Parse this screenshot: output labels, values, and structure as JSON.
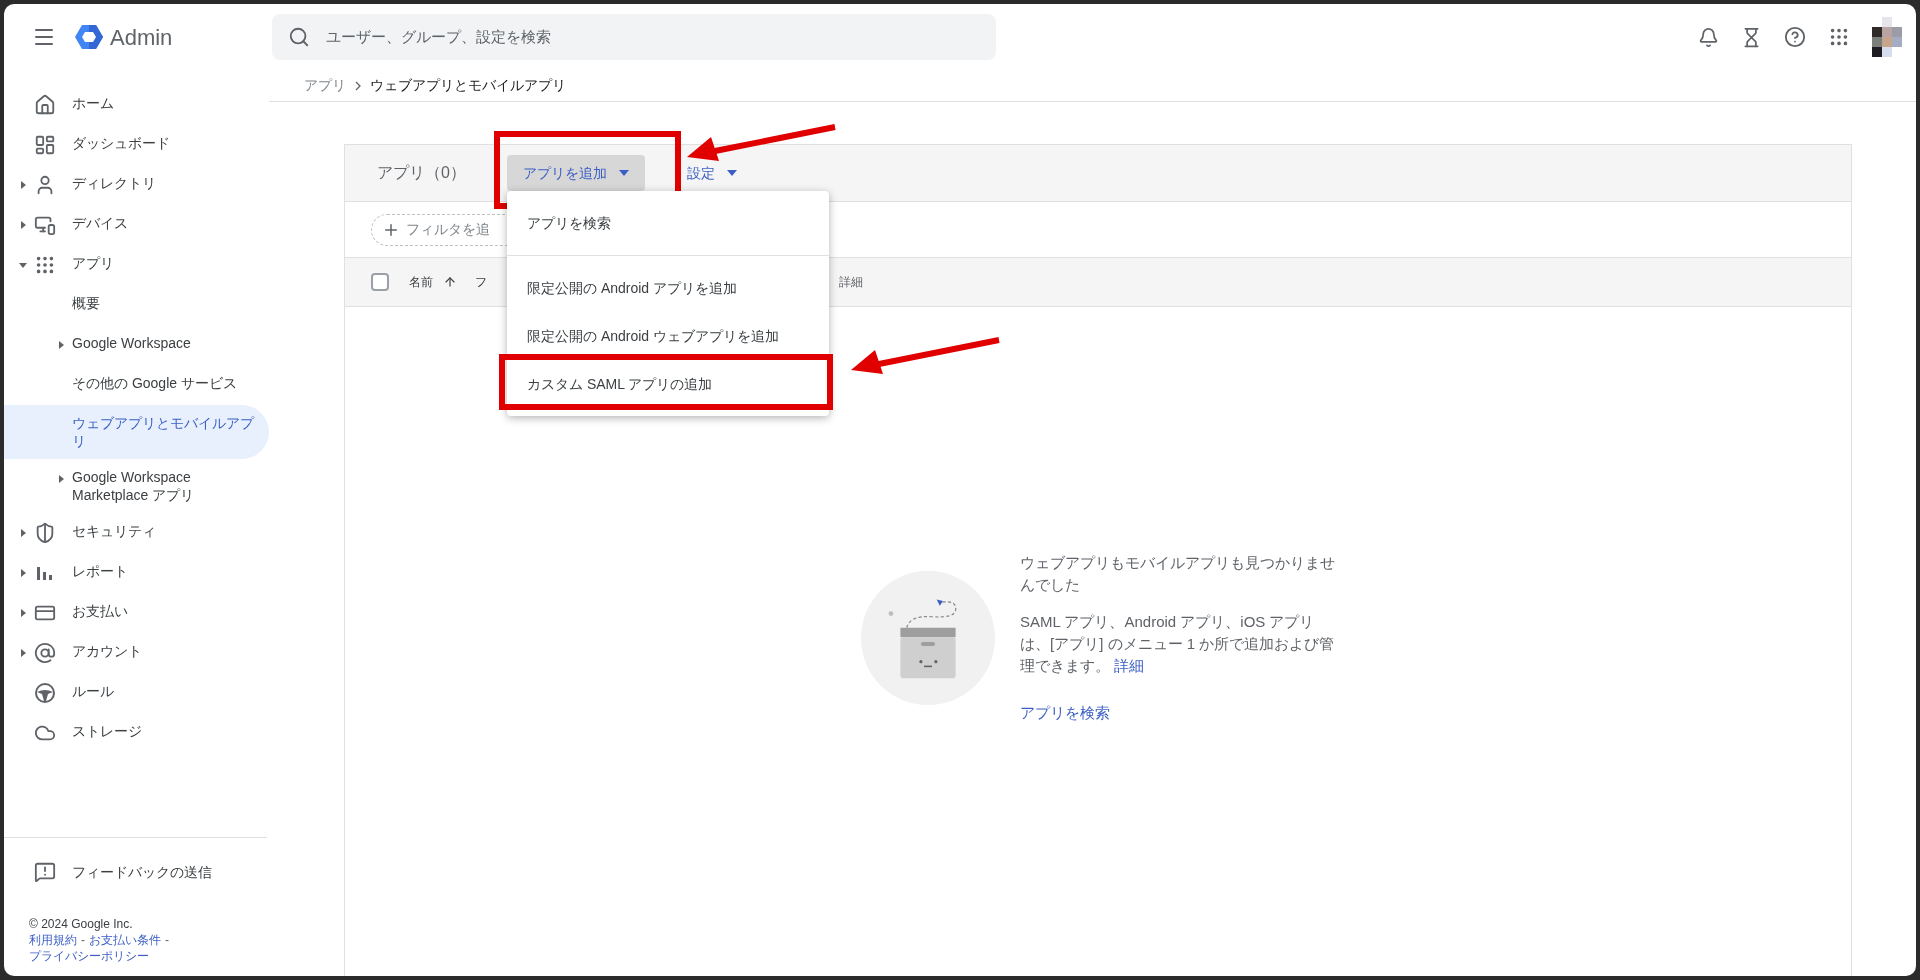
{
  "header": {
    "product": "Admin",
    "search": {
      "placeholder": "ユーザー、グループ、設定を検索"
    }
  },
  "sidebar": {
    "items": [
      {
        "kind": "link",
        "label": "ホーム"
      },
      {
        "kind": "link",
        "label": "ダッシュボード"
      },
      {
        "kind": "group",
        "label": "ディレクトリ",
        "expanded": false
      },
      {
        "kind": "group",
        "label": "デバイス",
        "expanded": false
      },
      {
        "kind": "group",
        "label": "アプリ",
        "expanded": true,
        "children": [
          {
            "kind": "link",
            "label": "概要",
            "selected": false
          },
          {
            "kind": "group",
            "label": "Google Workspace",
            "selected": false,
            "expanded": false
          },
          {
            "kind": "link",
            "label": "その他の Google サービス",
            "selected": false
          },
          {
            "kind": "link",
            "label": "ウェブアプリとモバイルアプリ",
            "selected": true
          },
          {
            "kind": "group",
            "label": "Google Workspace Marketplace アプリ",
            "selected": false,
            "expanded": false
          }
        ]
      },
      {
        "kind": "group",
        "label": "セキュリティ",
        "expanded": false
      },
      {
        "kind": "group",
        "label": "レポート",
        "expanded": false
      },
      {
        "kind": "group",
        "label": "お支払い",
        "expanded": false
      },
      {
        "kind": "group",
        "label": "アカウント",
        "expanded": false
      },
      {
        "kind": "link",
        "label": "ルール"
      },
      {
        "kind": "link",
        "label": "ストレージ"
      }
    ],
    "feedback": "フィードバックの送信",
    "copyright": "© 2024 Google Inc.",
    "separator": "-",
    "footer_links": [
      "利用規約",
      "お支払い条件",
      "プライバシーポリシー"
    ]
  },
  "breadcrumb": [
    "アプリ",
    "ウェブアプリとモバイルアプリ"
  ],
  "card": {
    "title": "アプリ（0）",
    "add_button": {
      "label": "アプリを追加",
      "highlighted": true
    },
    "settings_button": "設定",
    "filter_chip": "フィルタを追",
    "select_all": {
      "checked": false
    },
    "columns": [
      "名前",
      "フ",
      "詳細"
    ],
    "empty": {
      "title": "ウェブアプリもモバイルアプリも見つかりませんでした",
      "body": "SAML アプリ、Android アプリ、iOS アプリは、[アプリ] のメニュー 1 か所で追加および管理できます。",
      "details_link": "詳細",
      "search_link": "アプリを検索"
    }
  },
  "menu": {
    "sections": [
      [
        {
          "label": "アプリを検索",
          "highlighted": false
        }
      ],
      [
        {
          "label": "限定公開の Android アプリを追加",
          "highlighted": false
        },
        {
          "label": "限定公開の Android ウェブアプリを追加",
          "highlighted": false
        },
        {
          "label": "カスタム SAML アプリの追加",
          "highlighted": true
        }
      ]
    ]
  }
}
